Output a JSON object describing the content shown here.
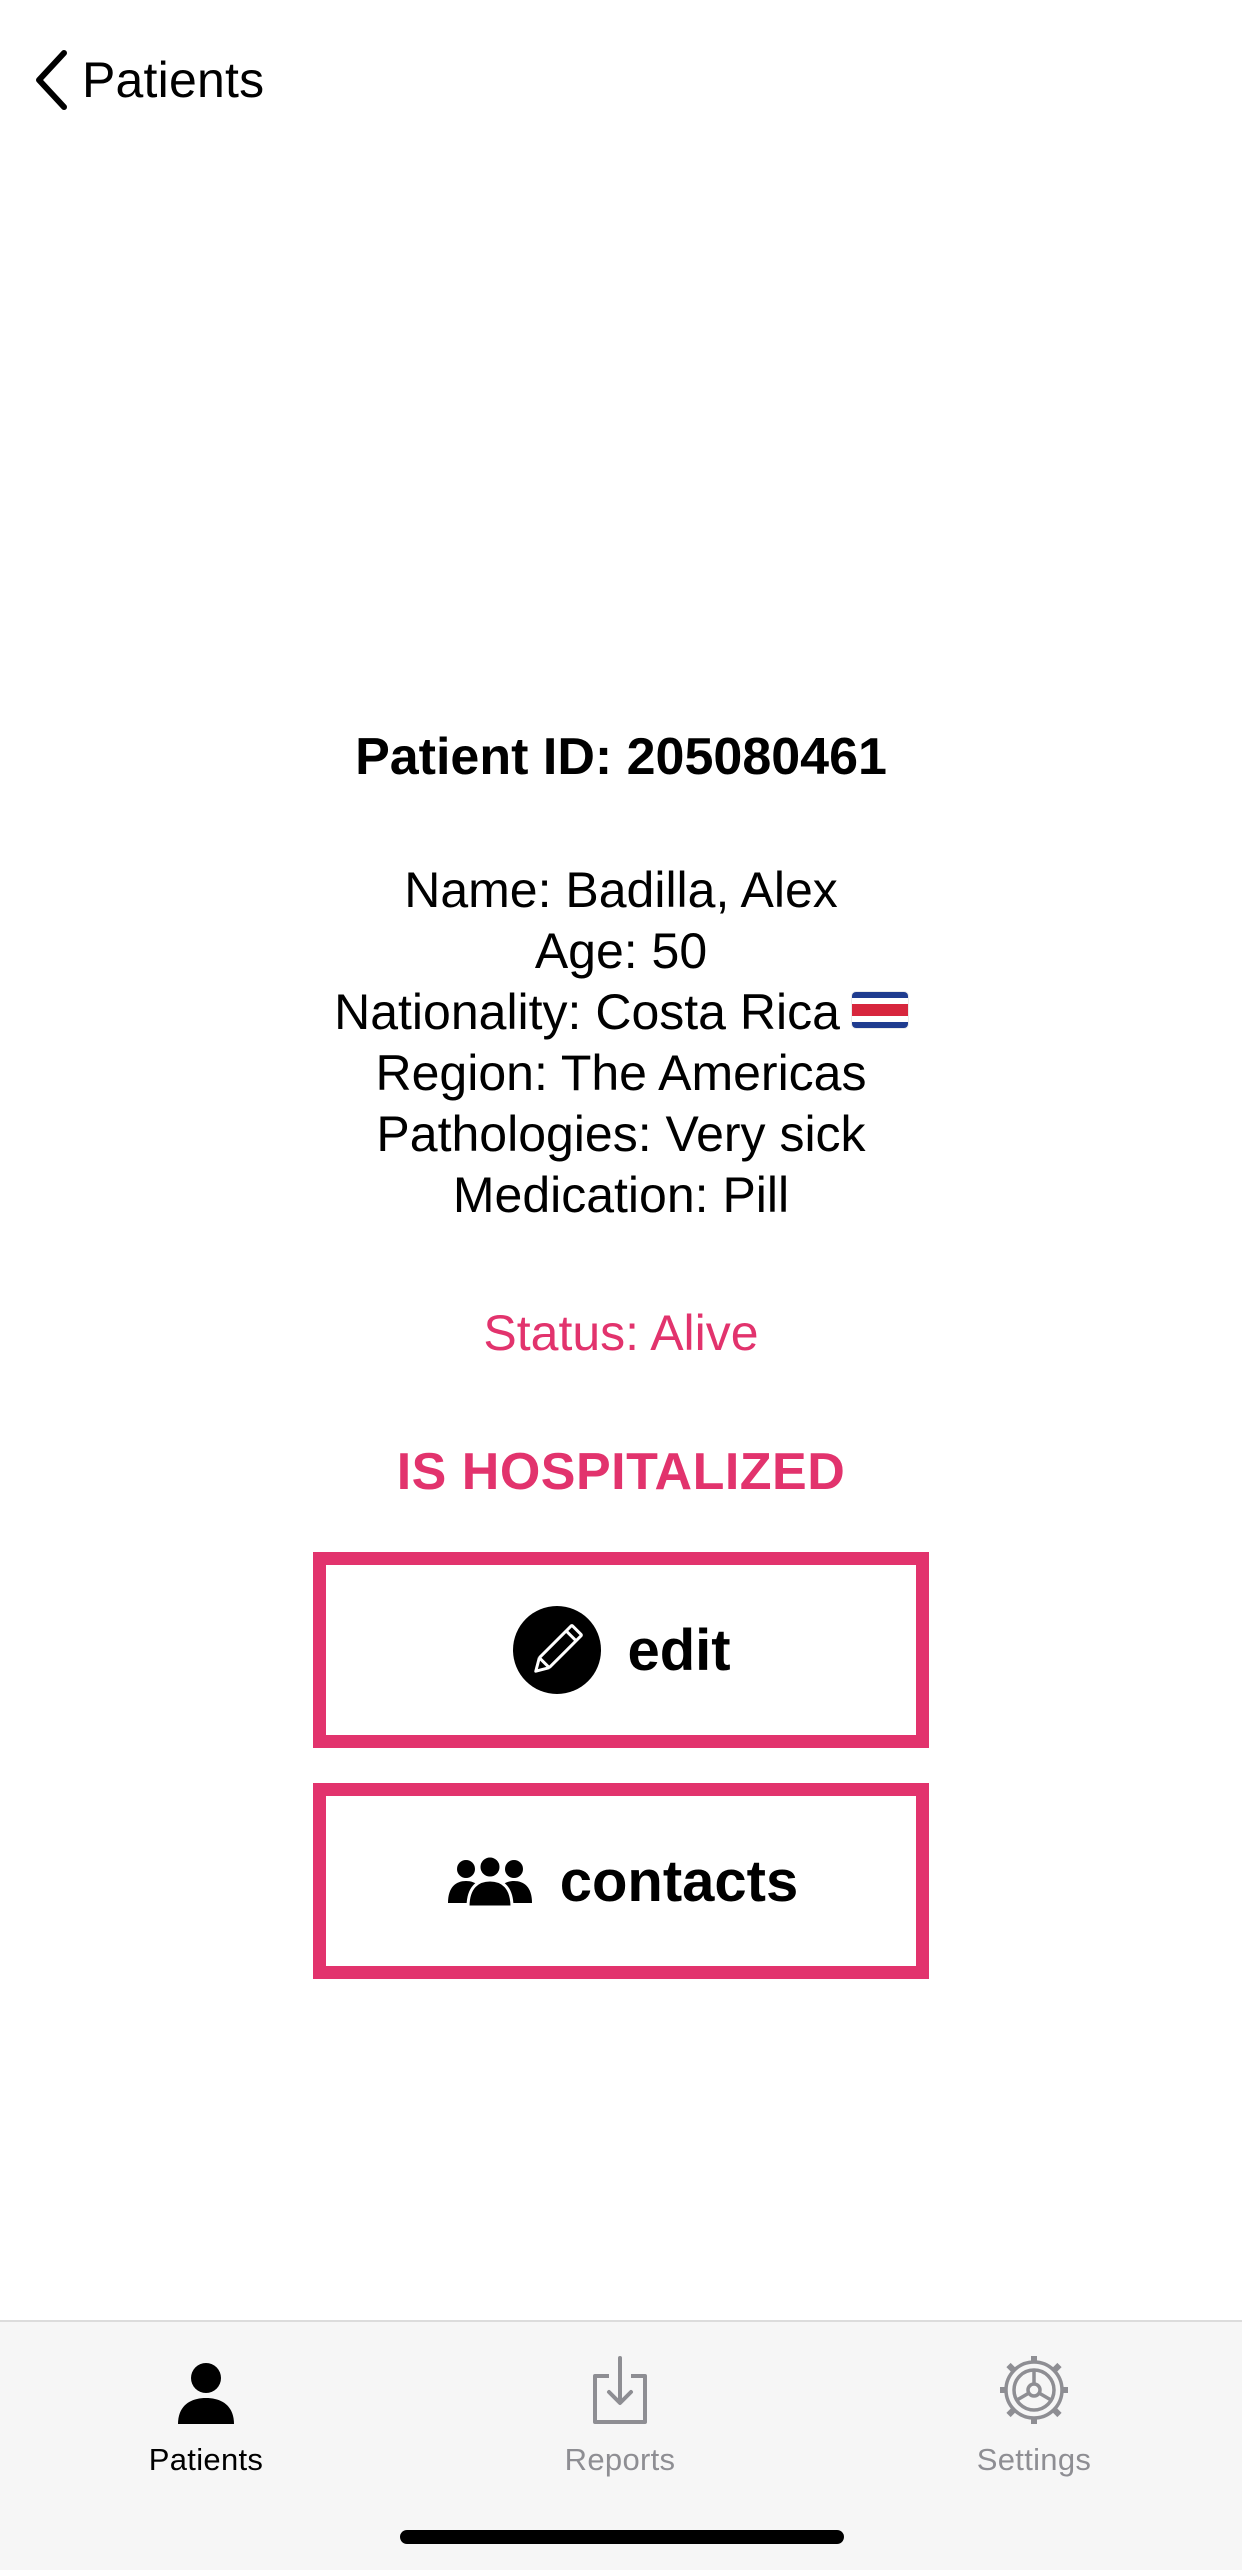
{
  "nav": {
    "back_label": "Patients"
  },
  "patient": {
    "id_line": "Patient ID: 205080461",
    "name_line": "Name: Badilla, Alex",
    "age_line": "Age: 50",
    "nationality_line": "Nationality: Costa Rica",
    "nationality_flag_icon": "costa-rica-flag-icon",
    "region_line": "Region: The Americas",
    "pathologies_line": "Pathologies: Very sick",
    "medication_line": "Medication: Pill",
    "status_line": "Status: Alive",
    "hospitalized_label": "IS HOSPITALIZED"
  },
  "actions": {
    "edit_label": "edit",
    "edit_icon": "pencil-circle-icon",
    "contacts_label": "contacts",
    "contacts_icon": "people-group-icon"
  },
  "tab_bar": {
    "items": [
      {
        "label": "Patients",
        "icon": "person-icon",
        "active": true
      },
      {
        "label": "Reports",
        "icon": "download-tray-icon",
        "active": false
      },
      {
        "label": "Settings",
        "icon": "gear-icon",
        "active": false
      }
    ]
  },
  "colors": {
    "accent": "#e2336d",
    "text": "#000000",
    "tab_inactive": "#8e8e93",
    "tab_active": "#000000",
    "tab_bar_bg": "#f6f6f6"
  }
}
